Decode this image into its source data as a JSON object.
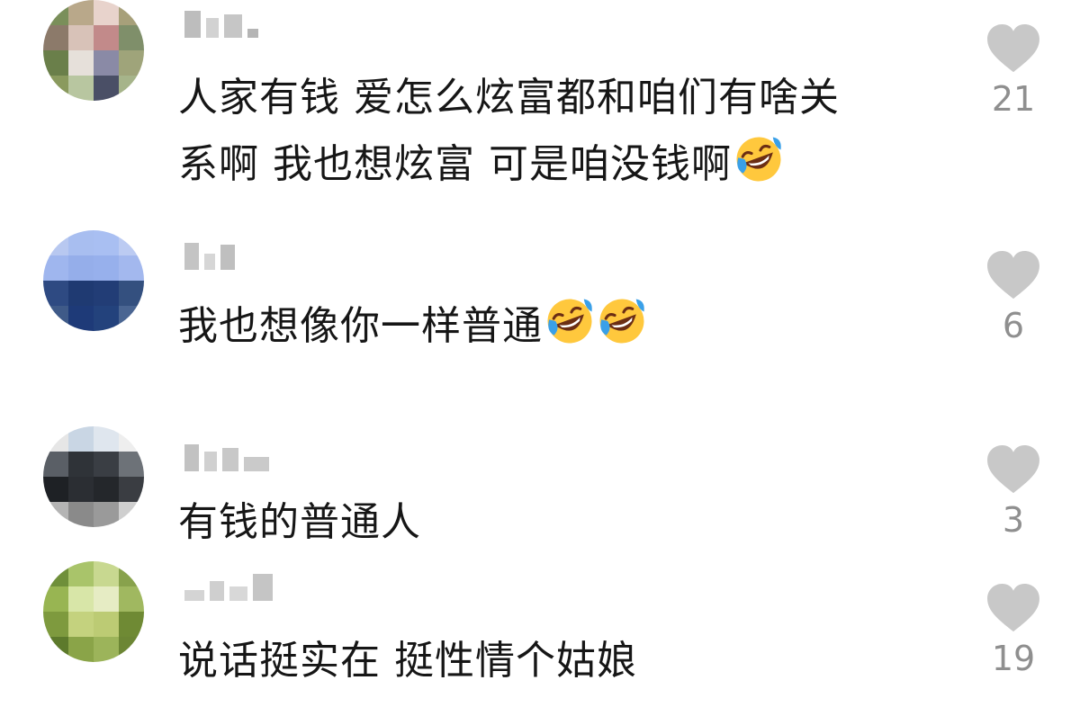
{
  "comments": [
    {
      "text_lines": [
        "人家有钱 爱怎么炫富都和咱们有啥关",
        "系啊 我也想炫富 可是咱没钱啊"
      ],
      "emojis": [
        "rofl-emoji"
      ],
      "likes": "21"
    },
    {
      "text_lines": [
        "我也想像你一样普通"
      ],
      "emojis": [
        "rofl-emoji",
        "rofl-emoji"
      ],
      "likes": "6"
    },
    {
      "text_lines": [
        "有钱的普通人"
      ],
      "emojis": [],
      "likes": "3"
    },
    {
      "text_lines": [
        "说话挺实在 挺性情个姑娘"
      ],
      "emojis": [],
      "likes": "19"
    }
  ],
  "colors": {
    "text": "#161616",
    "like_icon": "#c8c8c8",
    "like_count": "#8f8f8f",
    "emoji_face": "#ffc83d",
    "emoji_tear": "#3aa0e8"
  }
}
